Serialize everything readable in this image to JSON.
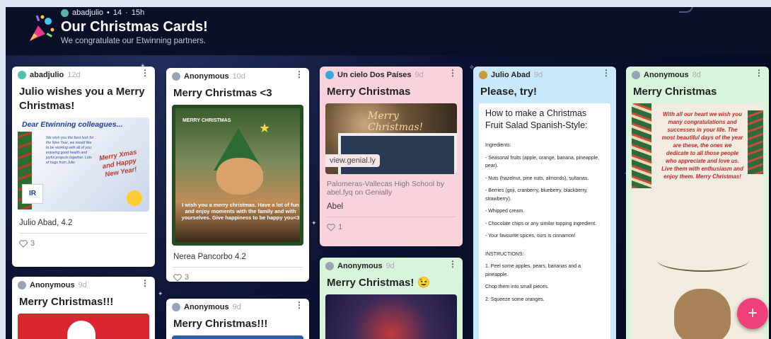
{
  "header": {
    "author": "abadjulio",
    "separator": "•",
    "count": "14",
    "time_separator": "·",
    "time": "15h",
    "title": "Our Christmas Cards!",
    "subtitle": "We congratulate our Etwinning partners."
  },
  "colors": {
    "accent": "#f0407a",
    "pink_card": "#f9d3dc",
    "blue_card": "#c9e9fb",
    "header_bg": "#0b1029"
  },
  "cards": {
    "c1": {
      "author": "abadjulio",
      "ago": "12d",
      "title": "Julio wishes you a Merry Christmas!",
      "img_heading": "Dear Etwinning colleagues...",
      "img_text": "We wish you the best luck for the New Year, we would like to be working with all of you, enjoying good health and joyful projects together. Lots of hugs from Julio",
      "img_banner": "Merry Xmas and Happy New Year!",
      "caption": "Julio Abad, 4.2",
      "likes": "3"
    },
    "c2": {
      "author": "Anonymous",
      "ago": "10d",
      "title": "Merry Christmas <3",
      "img_banner": "MERRY CHRISTMAS",
      "img_text": "I wish you a merry christmas. Have a lot of fun and enjoy moments with the family and with yourselves. Give happiness to be happy you<3",
      "caption": "Nerea Pancorbo 4.2",
      "likes": "3"
    },
    "c3": {
      "author": "Un cielo Dos Países",
      "ago": "9d",
      "title": "Merry Christmas",
      "img_script": "Merry Christmas!",
      "link": "view.genial.ly",
      "desc": "Palomeras-Vallecas High School by abel.fyq on Genially",
      "caption": "Abel",
      "likes": "1"
    },
    "c4": {
      "author": "Julio Abad",
      "ago": "9d",
      "title": "Please, try!",
      "doc_title": "How to make a Christmas Fruit Salad Spanish-Style:",
      "doc_lines": [
        "Ingredients:",
        "- Seasonal fruits (apple, orange, banana, pineapple, pear).",
        "- Nuts (hazelnut, pine nuts, almonds), sultanas.",
        "- Berries (goji, cranberry, blueberry, blackberry, strawberry).",
        "- Whipped cream.",
        "- Chocolate chips or any similar topping ingredient.",
        "- Your favourite spices, ours is cinnamon!",
        "INSTRUCTIONS:",
        "1. Peel some apples, pears, bananas and a pineapple.",
        "Chop them into small pieces.",
        "2. Squeeze some oranges."
      ]
    },
    "c5": {
      "author": "Anonymous",
      "ago": "8d",
      "title": "Merry Christmas",
      "img_text": "With all our heart we wish you many congratulations and successes in your life. The most beautiful days of the year are these, the ones we dedicate to all those people who appreciate and love us. Live them with enthusiasm and enjoy them. Merry Christmas!"
    },
    "c6": {
      "author": "Anonymous",
      "ago": "9d",
      "title": "Merry Christmas!!!"
    },
    "c7": {
      "author": "Anonymous",
      "ago": "9d",
      "title": "Merry Christmas!!!"
    },
    "c8": {
      "author": "Anonymous",
      "ago": "9d",
      "title": "Merry Christmas! 😉"
    }
  },
  "fab_label": "+"
}
